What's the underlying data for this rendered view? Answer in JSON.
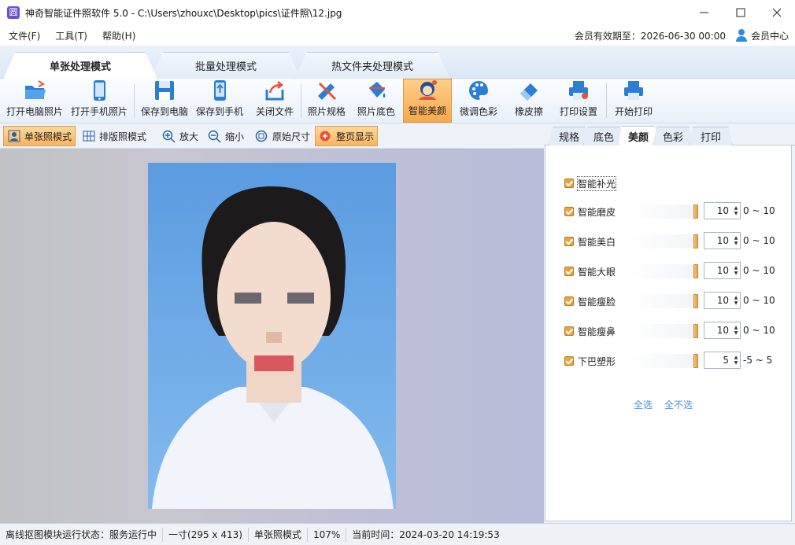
{
  "window": {
    "title": "神奇智能证件照软件 5.0 - C:\\Users\\zhouxc\\Desktop\\pics\\证件照\\12.jpg",
    "app_icon_glyph": "圆"
  },
  "menu": {
    "items": [
      "文件(F)",
      "工具(T)",
      "帮助(H)"
    ],
    "membership": "会员有效期至：2026-06-30 00:00",
    "member_center": "会员中心"
  },
  "modes": {
    "tabs": [
      {
        "label": "单张处理模式",
        "active": true
      },
      {
        "label": "批量处理模式",
        "active": false
      },
      {
        "label": "热文件夹处理模式",
        "active": false
      }
    ]
  },
  "toolbar": {
    "buttons": [
      {
        "label": "打开电脑照片",
        "icon": "folder-open-icon"
      },
      {
        "label": "打开手机照片",
        "icon": "phone-icon"
      },
      {
        "label": "保存到电脑",
        "icon": "save-icon"
      },
      {
        "label": "保存到手机",
        "icon": "phone-upload-icon"
      },
      {
        "label": "关闭文件",
        "icon": "close-file-icon"
      },
      {
        "label": "照片规格",
        "icon": "ruler-pencil-icon"
      },
      {
        "label": "照片底色",
        "icon": "paint-bucket-icon"
      },
      {
        "label": "智能美颜",
        "icon": "beauty-face-icon",
        "active": true
      },
      {
        "label": "微调色彩",
        "icon": "palette-icon"
      },
      {
        "label": "橡皮擦",
        "icon": "eraser-icon"
      },
      {
        "label": "打印设置",
        "icon": "print-settings-icon"
      },
      {
        "label": "开始打印",
        "icon": "printer-icon"
      }
    ]
  },
  "subbar": {
    "buttons": [
      {
        "label": "单张照模式",
        "icon": "portrait-icon",
        "active": true
      },
      {
        "label": "排版照模式",
        "icon": "grid-icon"
      },
      {
        "label": "放大",
        "icon": "zoom-in-icon"
      },
      {
        "label": "缩小",
        "icon": "zoom-out-icon"
      },
      {
        "label": "原始尺寸",
        "icon": "actual-size-icon"
      },
      {
        "label": "整页显示",
        "icon": "fit-page-icon",
        "active": true
      }
    ]
  },
  "panel": {
    "tabs": [
      {
        "label": "规格",
        "active": false
      },
      {
        "label": "底色",
        "active": false
      },
      {
        "label": "美颜",
        "active": true
      },
      {
        "label": "色彩",
        "active": false
      },
      {
        "label": "打印",
        "active": false
      }
    ],
    "options": [
      {
        "label": "智能补光",
        "checked": true
      },
      {
        "label": "智能磨皮",
        "checked": true,
        "value": "10",
        "range": "0 ~ 10"
      },
      {
        "label": "智能美白",
        "checked": true,
        "value": "10",
        "range": "0 ~ 10"
      },
      {
        "label": "智能大眼",
        "checked": true,
        "value": "10",
        "range": "0 ~ 10"
      },
      {
        "label": "智能瘦脸",
        "checked": true,
        "value": "10",
        "range": "0 ~ 10"
      },
      {
        "label": "智能瘦鼻",
        "checked": true,
        "value": "10",
        "range": "0 ~ 10"
      },
      {
        "label": "下巴塑形",
        "checked": true,
        "value": "5",
        "range": "-5 ~ 5"
      }
    ],
    "select_all": "全选",
    "select_none": "全不选"
  },
  "status": {
    "items": [
      "离线抠图模块运行状态：服务运行中",
      "一寸(295 x 413)",
      "单张照模式",
      "107%",
      "当前时间：2024-03-20 14:19:53"
    ]
  },
  "colors": {
    "accent": "#f7a84c",
    "link": "#4a8fd6",
    "photo_bg": "#6aa8e6"
  }
}
